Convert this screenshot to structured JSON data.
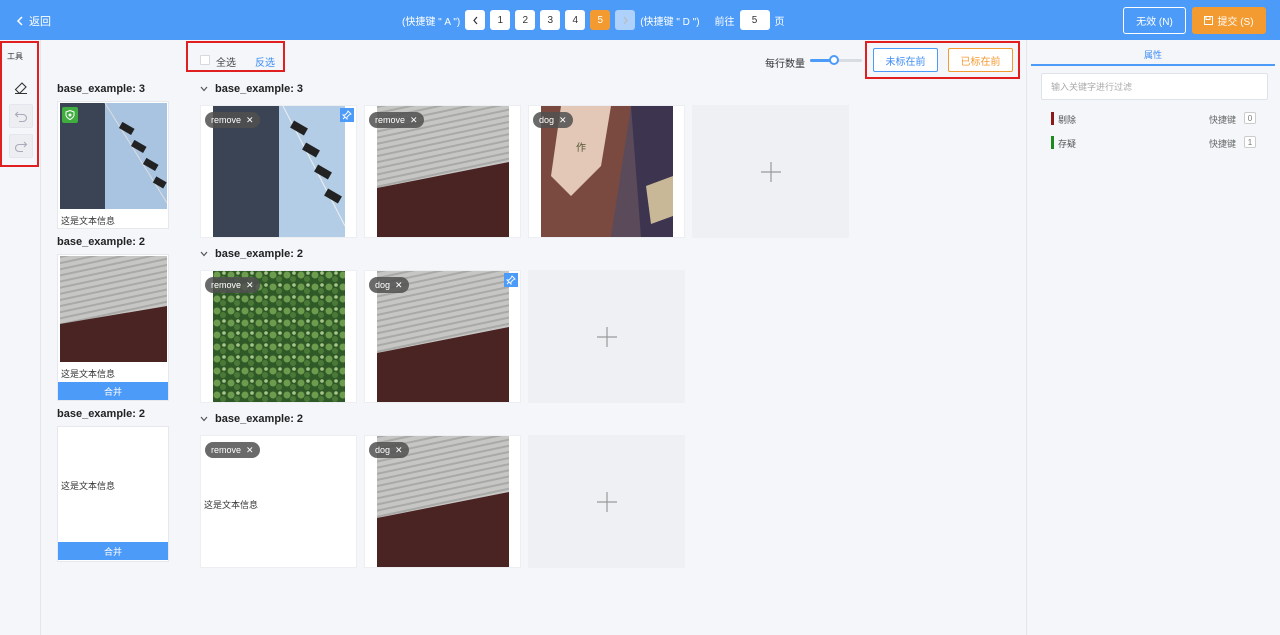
{
  "header": {
    "back": "返回",
    "prev_hint": "(快捷键 \" A \")",
    "next_hint": "(快捷键 \" D \")",
    "pages": [
      "1",
      "2",
      "3",
      "4",
      "5"
    ],
    "current_page": "5",
    "goto_label": "前往",
    "goto_value": "5",
    "page_unit": "页",
    "invalid_btn": "无效 (N)",
    "submit_btn": "提交 (S)"
  },
  "tools": {
    "title": "工具"
  },
  "preview": {
    "groups": [
      {
        "title": "base_example: 3",
        "text": "这是文本信息",
        "merge": ""
      },
      {
        "title": "base_example: 2",
        "text": "这是文本信息",
        "merge": "合并"
      },
      {
        "title": "base_example: 2",
        "text": "这是文本信息",
        "merge": "合并"
      }
    ]
  },
  "toolbar": {
    "select_all": "全选",
    "invert": "反选",
    "per_row_label": "每行数量",
    "per_row_level": 0.45,
    "unmarked_first": "未标在前",
    "marked_first": "已标在前"
  },
  "groups": [
    {
      "title": "base_example: 3",
      "items": [
        {
          "tag": "remove",
          "image": "mast-lights",
          "pinned": true
        },
        {
          "tag": "remove",
          "image": "siding-wall",
          "pinned": false
        },
        {
          "tag": "dog",
          "image": "banner-closeup",
          "pinned": false
        }
      ]
    },
    {
      "title": "base_example: 2",
      "items": [
        {
          "tag": "remove",
          "image": "green-tree",
          "pinned": false
        },
        {
          "tag": "dog",
          "image": "siding-wall",
          "pinned": true
        }
      ]
    },
    {
      "title": "base_example: 2",
      "items": [
        {
          "tag": "remove",
          "image": "",
          "text": "这是文本信息",
          "pinned": false
        },
        {
          "tag": "dog",
          "image": "siding-wall",
          "pinned": false
        }
      ]
    }
  ],
  "attributes": {
    "tab": "属性",
    "filter_placeholder": "输入关键字进行过滤",
    "items": [
      {
        "label": "剔除",
        "shortcut_label": "快捷键",
        "shortcut": "0",
        "color": "#8b1a1a"
      },
      {
        "label": "存疑",
        "shortcut_label": "快捷键",
        "shortcut": "1",
        "color": "#1e8a1e"
      }
    ]
  },
  "colors": {
    "primary": "#4d9bf8",
    "accent": "#f39a31",
    "highlight": "#e02020"
  }
}
